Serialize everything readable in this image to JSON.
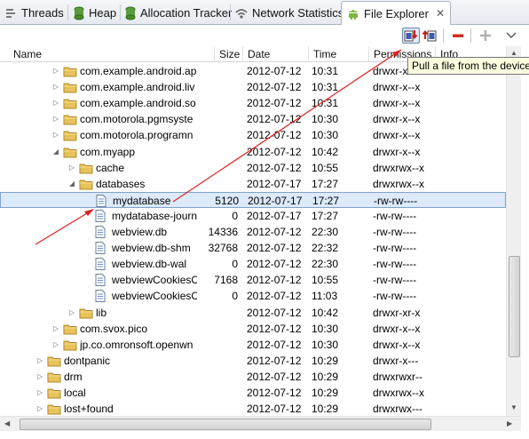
{
  "tabs": [
    {
      "label": "Threads",
      "icon": "threads-icon"
    },
    {
      "label": "Heap",
      "icon": "heap-icon"
    },
    {
      "label": "Allocation Tracker",
      "icon": "allocation-icon"
    },
    {
      "label": "Network Statistics",
      "icon": "network-icon"
    },
    {
      "label": "File Explorer",
      "icon": "android-icon",
      "active": true
    }
  ],
  "columns": {
    "name": "Name",
    "size": "Size",
    "date": "Date",
    "time": "Time",
    "permissions": "Permissions",
    "info": "Info"
  },
  "tooltip": "Pull a file from the device",
  "rows": [
    {
      "level": 3,
      "expander": "collapsed",
      "type": "folder",
      "name": "com.example.android.ap",
      "size": "",
      "date": "2012-07-12",
      "time": "10:31",
      "perm": "drwxr-x--x"
    },
    {
      "level": 3,
      "expander": "collapsed",
      "type": "folder",
      "name": "com.example.android.liv",
      "size": "",
      "date": "2012-07-12",
      "time": "10:31",
      "perm": "drwxr-x--x"
    },
    {
      "level": 3,
      "expander": "collapsed",
      "type": "folder",
      "name": "com.example.android.so",
      "size": "",
      "date": "2012-07-12",
      "time": "10:31",
      "perm": "drwxr-x--x"
    },
    {
      "level": 3,
      "expander": "collapsed",
      "type": "folder",
      "name": "com.motorola.pgmsyste",
      "size": "",
      "date": "2012-07-12",
      "time": "10:30",
      "perm": "drwxr-x--x"
    },
    {
      "level": 3,
      "expander": "collapsed",
      "type": "folder",
      "name": "com.motorola.programn",
      "size": "",
      "date": "2012-07-12",
      "time": "10:30",
      "perm": "drwxr-x--x"
    },
    {
      "level": 3,
      "expander": "expanded",
      "type": "folder",
      "name": "com.myapp",
      "size": "",
      "date": "2012-07-12",
      "time": "10:42",
      "perm": "drwxr-x--x"
    },
    {
      "level": 4,
      "expander": "collapsed",
      "type": "folder",
      "name": "cache",
      "size": "",
      "date": "2012-07-12",
      "time": "10:55",
      "perm": "drwxrwx--x"
    },
    {
      "level": 4,
      "expander": "expanded",
      "type": "folder",
      "name": "databases",
      "size": "",
      "date": "2012-07-17",
      "time": "17:27",
      "perm": "drwxrwx--x"
    },
    {
      "level": 5,
      "expander": "none",
      "type": "file",
      "name": "mydatabase",
      "size": "5120",
      "date": "2012-07-17",
      "time": "17:27",
      "perm": "-rw-rw----",
      "selected": true
    },
    {
      "level": 5,
      "expander": "none",
      "type": "file",
      "name": "mydatabase-journ",
      "size": "0",
      "date": "2012-07-17",
      "time": "17:27",
      "perm": "-rw-rw----"
    },
    {
      "level": 5,
      "expander": "none",
      "type": "file",
      "name": "webview.db",
      "size": "14336",
      "date": "2012-07-12",
      "time": "22:30",
      "perm": "-rw-rw----"
    },
    {
      "level": 5,
      "expander": "none",
      "type": "file",
      "name": "webview.db-shm",
      "size": "32768",
      "date": "2012-07-12",
      "time": "22:32",
      "perm": "-rw-rw----"
    },
    {
      "level": 5,
      "expander": "none",
      "type": "file",
      "name": "webview.db-wal",
      "size": "0",
      "date": "2012-07-12",
      "time": "22:30",
      "perm": "-rw-rw----"
    },
    {
      "level": 5,
      "expander": "none",
      "type": "file",
      "name": "webviewCookiesC",
      "size": "7168",
      "date": "2012-07-12",
      "time": "10:55",
      "perm": "-rw-rw----"
    },
    {
      "level": 5,
      "expander": "none",
      "type": "file",
      "name": "webviewCookiesC",
      "size": "0",
      "date": "2012-07-12",
      "time": "11:03",
      "perm": "-rw-rw----"
    },
    {
      "level": 4,
      "expander": "collapsed",
      "type": "folder",
      "name": "lib",
      "size": "",
      "date": "2012-07-12",
      "time": "10:42",
      "perm": "drwxr-xr-x"
    },
    {
      "level": 3,
      "expander": "collapsed",
      "type": "folder",
      "name": "com.svox.pico",
      "size": "",
      "date": "2012-07-12",
      "time": "10:30",
      "perm": "drwxr-x--x"
    },
    {
      "level": 3,
      "expander": "collapsed",
      "type": "folder",
      "name": "jp.co.omronsoft.openwn",
      "size": "",
      "date": "2012-07-12",
      "time": "10:30",
      "perm": "drwxr-x--x"
    },
    {
      "level": 2,
      "expander": "collapsed",
      "type": "folder",
      "name": "dontpanic",
      "size": "",
      "date": "2012-07-12",
      "time": "10:29",
      "perm": "drwxr-x---"
    },
    {
      "level": 2,
      "expander": "collapsed",
      "type": "folder",
      "name": "drm",
      "size": "",
      "date": "2012-07-12",
      "time": "10:29",
      "perm": "drwxrwxr--"
    },
    {
      "level": 2,
      "expander": "collapsed",
      "type": "folder",
      "name": "local",
      "size": "",
      "date": "2012-07-12",
      "time": "10:29",
      "perm": "drwxrwx--x"
    },
    {
      "level": 2,
      "expander": "collapsed",
      "type": "folder",
      "name": "lost+found",
      "size": "",
      "date": "2012-07-12",
      "time": "10:29",
      "perm": "drwxrwx---"
    }
  ],
  "colors": {
    "selection": "#dceafc",
    "selection_border": "#7da2ce",
    "folder": "#e8c25a",
    "annotation": "#e02020"
  }
}
